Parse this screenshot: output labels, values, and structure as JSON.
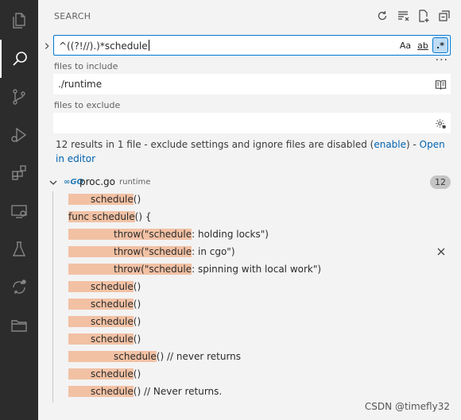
{
  "activity_bar": {
    "items": [
      {
        "icon": "explorer-files-icon"
      },
      {
        "icon": "search-icon",
        "active": true
      },
      {
        "icon": "source-control-icon"
      },
      {
        "icon": "run-debug-icon"
      },
      {
        "icon": "extensions-icon"
      },
      {
        "icon": "remote-explorer-icon"
      },
      {
        "icon": "testing-flask-icon"
      },
      {
        "icon": "live-share-icon"
      },
      {
        "icon": "folder-icon"
      }
    ]
  },
  "sidebar": {
    "title": "SEARCH",
    "title_actions": [
      "refresh-icon",
      "clear-results-icon",
      "new-search-editor-icon",
      "collapse-all-icon"
    ]
  },
  "search": {
    "value": "^((?!//).)*schedule",
    "options": {
      "match_case": "Aa",
      "whole_word": "ab",
      "regex": ".*"
    },
    "more": "···"
  },
  "include": {
    "label": "files to include",
    "value": "./runtime"
  },
  "exclude": {
    "label": "files to exclude",
    "value": ""
  },
  "summary": {
    "text": "12 results in 1 file - exclude settings and ignore files are disabled (",
    "enable_link": "enable",
    "middle": ") - ",
    "open_link": "Open in editor"
  },
  "results": {
    "file": {
      "icon_text": "∞GO",
      "name": "proc.go",
      "dir": "runtime",
      "count": "12"
    },
    "matches": [
      {
        "indent": 1,
        "pre": "",
        "hit": "schedule",
        "post": "()"
      },
      {
        "indent": 0,
        "pre": "func ",
        "hit": "schedule",
        "post": "() {"
      },
      {
        "indent": 2,
        "pre": "throw(\"",
        "hit": "schedule",
        "post": ": holding locks\")"
      },
      {
        "indent": 2,
        "pre": "throw(\"",
        "hit": "schedule",
        "post": ": in cgo\")"
      },
      {
        "indent": 2,
        "pre": "throw(\"",
        "hit": "schedule",
        "post": ": spinning with local work\")"
      },
      {
        "indent": 1,
        "pre": "",
        "hit": "schedule",
        "post": "()"
      },
      {
        "indent": 1,
        "pre": "",
        "hit": "schedule",
        "post": "()"
      },
      {
        "indent": 1,
        "pre": "",
        "hit": "schedule",
        "post": "()"
      },
      {
        "indent": 1,
        "pre": "",
        "hit": "schedule",
        "post": "()"
      },
      {
        "indent": 2,
        "pre": "",
        "hit": "schedule",
        "post": "() // never returns"
      },
      {
        "indent": 1,
        "pre": "",
        "hit": "schedule",
        "post": "()"
      },
      {
        "indent": 1,
        "pre": "",
        "hit": "schedule",
        "post": "() // Never returns."
      }
    ]
  },
  "watermark": "CSDN @timefly32",
  "colors": {
    "activity_bar": "#2c2c2c",
    "sidebar": "#f3f3f3",
    "focus_border": "#0078d4",
    "match_highlight": "#f2c1a4",
    "link": "#0063b1"
  }
}
